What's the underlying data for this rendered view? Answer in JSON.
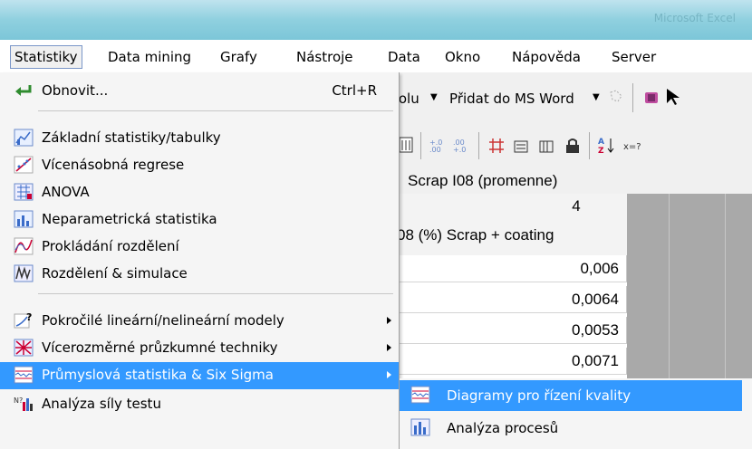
{
  "window": {
    "title": "Microsoft Excel"
  },
  "menubar": {
    "items": [
      {
        "label": "Statistiky"
      },
      {
        "label": "Data mining"
      },
      {
        "label": "Grafy"
      },
      {
        "label": "Nástroje"
      },
      {
        "label": "Data"
      },
      {
        "label": "Okno"
      },
      {
        "label": "Nápověda"
      },
      {
        "label": "Server"
      }
    ]
  },
  "toolbar": {
    "stolu_label": "tolu",
    "word_label": "Přidat do MS Word"
  },
  "sheet": {
    "header_text": "Scrap I08 (promenne)",
    "column_number": "4",
    "column_name": "08 (%) Scrap + coating",
    "values": [
      "0,006",
      "0,0064",
      "0,0053",
      "0,0071"
    ]
  },
  "dropdown": {
    "refresh": {
      "label": "Obnovit...",
      "shortcut": "Ctrl+R"
    },
    "items": [
      {
        "label": "Základní statistiky/tabulky"
      },
      {
        "label": "Vícenásobná regrese"
      },
      {
        "label": "ANOVA"
      },
      {
        "label": "Neparametrická statistika"
      },
      {
        "label": "Prokládání rozdělení"
      },
      {
        "label": "Rozdělení & simulace"
      },
      {
        "label": "Pokročilé lineární/nelineární modely"
      },
      {
        "label": "Vícerozměrné průzkumné techniky"
      },
      {
        "label": "Průmyslová statistika & Six Sigma"
      },
      {
        "label": "Analýza síly testu"
      }
    ]
  },
  "submenu": {
    "items": [
      {
        "label": "Diagramy pro řízení kvality"
      },
      {
        "label": "Analýza procesů"
      }
    ]
  },
  "colors": {
    "highlight": "#3399ff",
    "titlebar": "#8fd0df"
  }
}
